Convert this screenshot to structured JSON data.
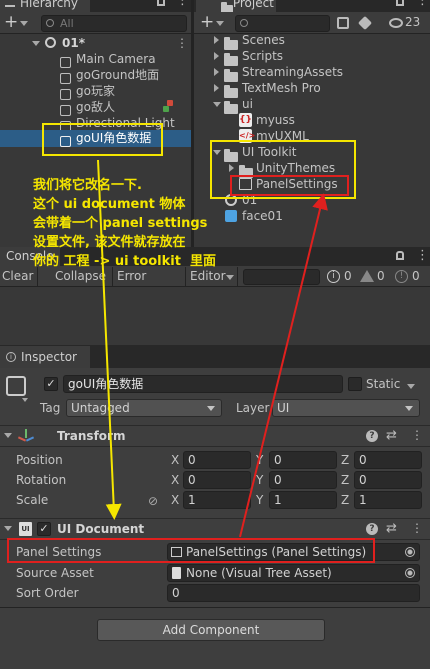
{
  "hierarchy": {
    "tab": "Hierarchy",
    "search_placeholder": "All",
    "scene": "01*",
    "items": [
      {
        "label": "Main Camera"
      },
      {
        "label": "goGround地面"
      },
      {
        "label": "go玩家"
      },
      {
        "label": "go敌人"
      },
      {
        "label": "Directional Light"
      },
      {
        "label": "goUI角色数据"
      }
    ]
  },
  "project": {
    "tab": "Project",
    "hidden_count": "23",
    "items": [
      {
        "label": "Scenes",
        "kind": "folder"
      },
      {
        "label": "Scripts",
        "kind": "folder"
      },
      {
        "label": "StreamingAssets",
        "kind": "folder"
      },
      {
        "label": "TextMesh Pro",
        "kind": "folder"
      },
      {
        "label": "ui",
        "kind": "folder"
      },
      {
        "label": "myuss",
        "kind": "uss"
      },
      {
        "label": "myUXML",
        "kind": "uxml"
      },
      {
        "label": "UI Toolkit",
        "kind": "folder"
      },
      {
        "label": "UnityThemes",
        "kind": "folder"
      },
      {
        "label": "PanelSettings",
        "kind": "asset"
      },
      {
        "label": "01",
        "kind": "scene"
      },
      {
        "label": "face01",
        "kind": "prefab"
      }
    ]
  },
  "console": {
    "tab": "Console",
    "buttons": [
      "Clear",
      "Collapse",
      "Error Pause",
      "Editor"
    ],
    "counts": {
      "log": "0",
      "warn": "0",
      "error": "0"
    }
  },
  "annotation": {
    "text": "我们将它改名一下.\n这个 ui document 物体\n会带着一个 panel settings\n设置文件, 该文件就存放在\n你的 工程 -> ui toolkit  里面"
  },
  "inspector": {
    "tab": "Inspector",
    "object_name": "goUI角色数据",
    "static_label": "Static",
    "tag_label": "Tag",
    "tag_value": "Untagged",
    "layer_label": "Layer",
    "layer_value": "UI",
    "transform": {
      "title": "Transform",
      "position": {
        "label": "Position",
        "x": "0",
        "y": "0",
        "z": "0"
      },
      "rotation": {
        "label": "Rotation",
        "x": "0",
        "y": "0",
        "z": "0"
      },
      "scale": {
        "label": "Scale",
        "x": "1",
        "y": "1",
        "z": "1"
      },
      "axis": {
        "x": "X",
        "y": "Y",
        "z": "Z"
      }
    },
    "ui_document": {
      "title": "UI Document",
      "icon_text": "UI",
      "panel_settings_label": "Panel Settings",
      "panel_settings_value": "PanelSettings (Panel Settings)",
      "source_asset_label": "Source Asset",
      "source_asset_value": "None (Visual Tree Asset)",
      "sort_order_label": "Sort Order",
      "sort_order_value": "0"
    },
    "add_component": "Add Component"
  },
  "colors": {
    "annotation_yellow": "#f5e600",
    "annotation_red": "#e0201e",
    "selection": "#2c5d87"
  }
}
